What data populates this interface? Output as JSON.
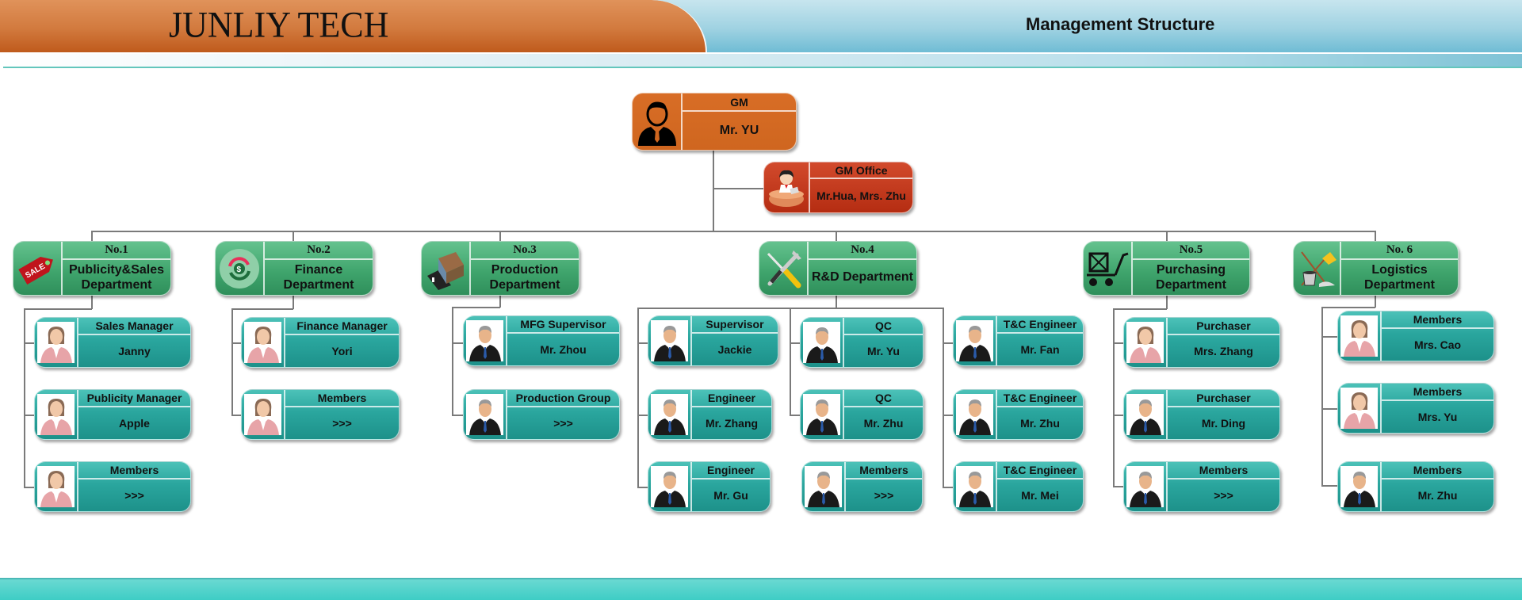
{
  "header": {
    "brand": "JUNLIY TECH",
    "title": "Management Structure"
  },
  "colors": {
    "banner_orange": "#d27a3e",
    "banner_blue": "#9fd2e2",
    "gm_box": "#d06820",
    "office_box": "#c03a1c",
    "dept_box": "#45a872",
    "person_box": "#2aa69e",
    "footer": "#3ecdc5"
  },
  "gm": {
    "role": "GM",
    "name": "Mr. YU",
    "icon": "businessman-icon"
  },
  "gm_office": {
    "role": "GM Office",
    "name": "Mr.Hua, Mrs. Zhu",
    "icon": "secretary-icon"
  },
  "departments": [
    {
      "number": "No.1",
      "name": "Publicity&Sales Department",
      "icon": "sale-tag-icon",
      "members": [
        {
          "role": "Sales Manager",
          "name": "Janny",
          "avatar": "female"
        },
        {
          "role": "Publicity Manager",
          "name": "Apple",
          "avatar": "female"
        },
        {
          "role": "Members",
          "name": ">>>",
          "avatar": "female"
        }
      ]
    },
    {
      "number": "No.2",
      "name": "Finance Department",
      "icon": "money-cycle-icon",
      "members": [
        {
          "role": "Finance Manager",
          "name": "Yori",
          "avatar": "female"
        },
        {
          "role": "Members",
          "name": ">>>",
          "avatar": "female"
        }
      ]
    },
    {
      "number": "No.3",
      "name": "Production Department",
      "icon": "factory-icon",
      "members": [
        {
          "role": "MFG Supervisor",
          "name": "Mr. Zhou",
          "avatar": "male"
        },
        {
          "role": "Production Group",
          "name": ">>>",
          "avatar": "male"
        }
      ]
    },
    {
      "number": "No.4",
      "name": "R&D Department",
      "icon": "tools-icon",
      "members": [
        {
          "role": "Supervisor",
          "name": "Jackie",
          "avatar": "male"
        },
        {
          "role": "Engineer",
          "name": "Mr. Zhang",
          "avatar": "male"
        },
        {
          "role": "Engineer",
          "name": "Mr. Gu",
          "avatar": "male"
        },
        {
          "role": "QC",
          "name": "Mr. Yu",
          "avatar": "male"
        },
        {
          "role": "QC",
          "name": "Mr. Zhu",
          "avatar": "male"
        },
        {
          "role": "Members",
          "name": ">>>",
          "avatar": "male"
        },
        {
          "role": "T&C Engineer",
          "name": "Mr. Fan",
          "avatar": "male"
        },
        {
          "role": "T&C Engineer",
          "name": "Mr. Zhu",
          "avatar": "male"
        },
        {
          "role": "T&C Engineer",
          "name": "Mr. Mei",
          "avatar": "male"
        }
      ]
    },
    {
      "number": "No.5",
      "name": "Purchasing Department",
      "icon": "cart-icon",
      "members": [
        {
          "role": "Purchaser",
          "name": "Mrs. Zhang",
          "avatar": "female"
        },
        {
          "role": "Purchaser",
          "name": "Mr. Ding",
          "avatar": "male"
        },
        {
          "role": "Members",
          "name": ">>>",
          "avatar": "male"
        }
      ]
    },
    {
      "number": "No. 6",
      "name": "Logistics Department",
      "icon": "broom-bucket-icon",
      "members": [
        {
          "role": "Members",
          "name": "Mrs. Cao",
          "avatar": "female"
        },
        {
          "role": "Members",
          "name": "Mrs. Yu",
          "avatar": "female"
        },
        {
          "role": "Members",
          "name": "Mr. Zhu",
          "avatar": "male"
        }
      ]
    }
  ]
}
